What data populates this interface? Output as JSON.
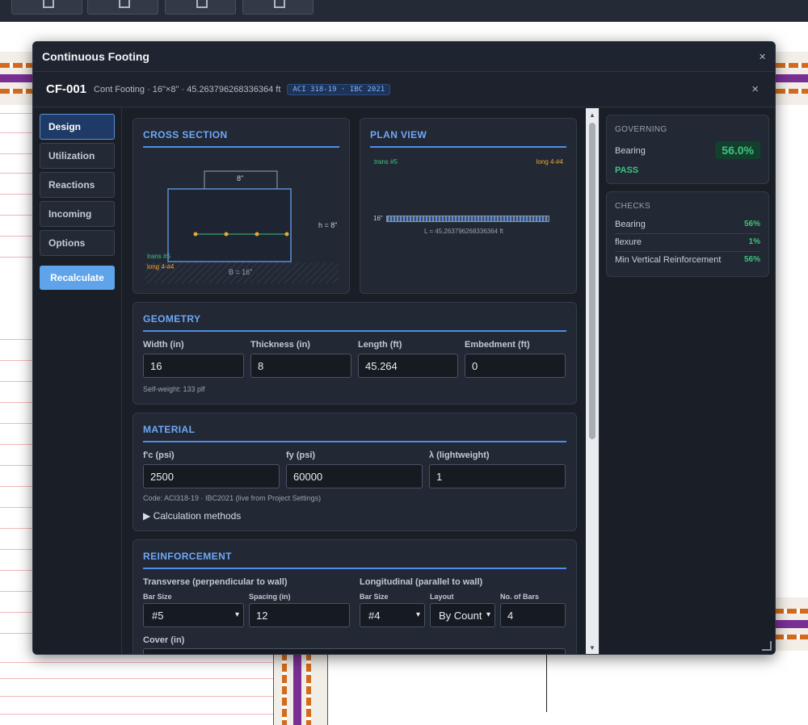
{
  "modal": {
    "title": "Continuous Footing",
    "close_icon": "×"
  },
  "element": {
    "id": "CF-001",
    "description": "Cont Footing · 16\"×8\" · 45.263796268336364 ft",
    "code_badge": "ACI 318-19 · IBC 2021",
    "close_icon": "×"
  },
  "nav": {
    "items": [
      "Design",
      "Utilization",
      "Reactions",
      "Incoming",
      "Options"
    ],
    "active": "Design",
    "recalculate": "Recalculate"
  },
  "cross_section": {
    "title": "CROSS SECTION",
    "wall_width_label": "8\"",
    "height_label": "h = 8\"",
    "base_label": "B = 16\"",
    "trans_label": "trans #5",
    "long_label": "long 4-#4"
  },
  "plan_view": {
    "title": "PLAN VIEW",
    "trans_label": "trans #5",
    "long_label": "long 4-#4",
    "width_label": "16\"",
    "length_label": "L = 45.263796268336364 ft"
  },
  "geometry": {
    "title": "GEOMETRY",
    "fields": [
      {
        "label": "Width (in)",
        "value": "16"
      },
      {
        "label": "Thickness (in)",
        "value": "8"
      },
      {
        "label": "Length (ft)",
        "value": "45.264"
      },
      {
        "label": "Embedment (ft)",
        "value": "0"
      }
    ],
    "note": "Self-weight: 133 plf"
  },
  "material": {
    "title": "MATERIAL",
    "fields": [
      {
        "label": "f'c (psi)",
        "value": "2500"
      },
      {
        "label": "fy (psi)",
        "value": "60000"
      },
      {
        "label": "λ (lightweight)",
        "value": "1"
      }
    ],
    "note": "Code: ACI318-19 · IBC2021 (live from Project Settings)",
    "methods": "▶ Calculation methods"
  },
  "reinforcement": {
    "title": "REINFORCEMENT",
    "transverse_label": "Transverse (perpendicular to wall)",
    "longitudinal_label": "Longitudinal (parallel to wall)",
    "t_bar_size_label": "Bar Size",
    "t_bar_size": "#5",
    "t_spacing_label": "Spacing (in)",
    "t_spacing": "12",
    "l_bar_size_label": "Bar Size",
    "l_bar_size": "#4",
    "l_layout_label": "Layout",
    "l_layout": "By Count",
    "l_count_label": "No. of Bars",
    "l_count": "4",
    "cover_label": "Cover (in)"
  },
  "governing": {
    "header": "GOVERNING",
    "check": "Bearing",
    "ratio": "56.0%",
    "status": "PASS"
  },
  "checks": {
    "header": "CHECKS",
    "rows": [
      {
        "name": "Bearing",
        "value": "56%"
      },
      {
        "name": "flexure",
        "value": "1%"
      },
      {
        "name": "Min Vertical Reinforcement",
        "value": "56%"
      }
    ]
  },
  "colors": {
    "accent": "#6ea8f7",
    "pass": "#3ec47e",
    "trans_bar": "#3ec47e",
    "long_bar": "#f0a830"
  }
}
